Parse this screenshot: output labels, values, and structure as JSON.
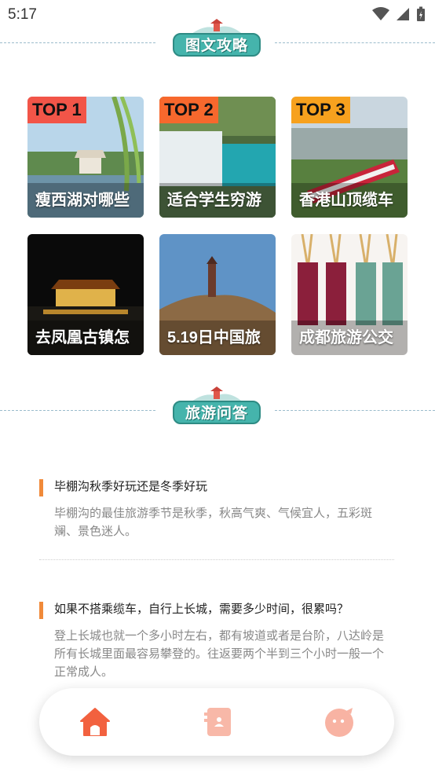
{
  "status": {
    "time": "5:17"
  },
  "sections": {
    "guide_title": "图文攻略",
    "qa_title": "旅游问答"
  },
  "cards": [
    {
      "rank": "TOP 1",
      "title": "瘦西湖对哪些",
      "rank_color": "#f25548"
    },
    {
      "rank": "TOP 2",
      "title": "适合学生穷游",
      "rank_color": "#f7682d"
    },
    {
      "rank": "TOP 3",
      "title": "香港山顶缆车",
      "rank_color": "#f7a11e"
    },
    {
      "rank": "",
      "title": "去凤凰古镇怎"
    },
    {
      "rank": "",
      "title": "5.19日中国旅"
    },
    {
      "rank": "",
      "title": "成都旅游公交"
    }
  ],
  "qa": [
    {
      "question": "毕棚沟秋季好玩还是冬季好玩",
      "answer": "毕棚沟的最佳旅游季节是秋季，秋高气爽、气候宜人，五彩斑斓、景色迷人。"
    },
    {
      "question": "如果不搭乘缆车，自行上长城，需要多少时间，很累吗？",
      "answer": "登上长城也就一个多小时左右，都有坡道或者是台阶，八达岭是所有长城里面最容易攀登的。往返要两个半到三个小时一般一个正常成人。"
    }
  ],
  "nav": {
    "items": [
      {
        "icon": "home-icon"
      },
      {
        "icon": "contact-card-icon"
      },
      {
        "icon": "profile-face-icon"
      }
    ],
    "accent": "#f2613f"
  }
}
